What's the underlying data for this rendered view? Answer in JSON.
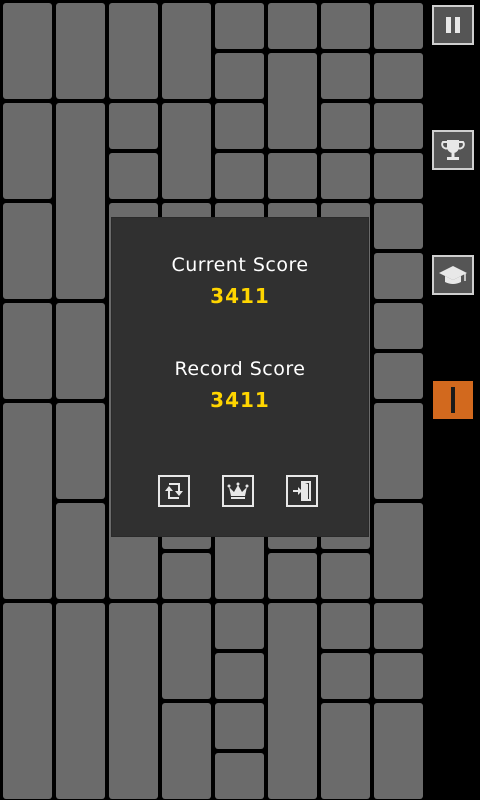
{
  "dialog": {
    "current_label": "Current Score",
    "current_value": "3411",
    "record_label": "Record Score",
    "record_value": "3411",
    "buttons": [
      {
        "icon": "restart-icon"
      },
      {
        "icon": "crown-icon"
      },
      {
        "icon": "exit-door-icon"
      }
    ]
  },
  "sidebar": {
    "buttons": [
      {
        "icon": "pause-icon"
      },
      {
        "icon": "trophy-icon"
      },
      {
        "icon": "graduation-cap-icon"
      },
      {
        "icon": "level-bar-icon"
      }
    ]
  },
  "colors": {
    "tile": "#6b6b6b",
    "dialog_bg": "#303030",
    "score_value": "#ffd500",
    "accent": "#d2691e"
  }
}
